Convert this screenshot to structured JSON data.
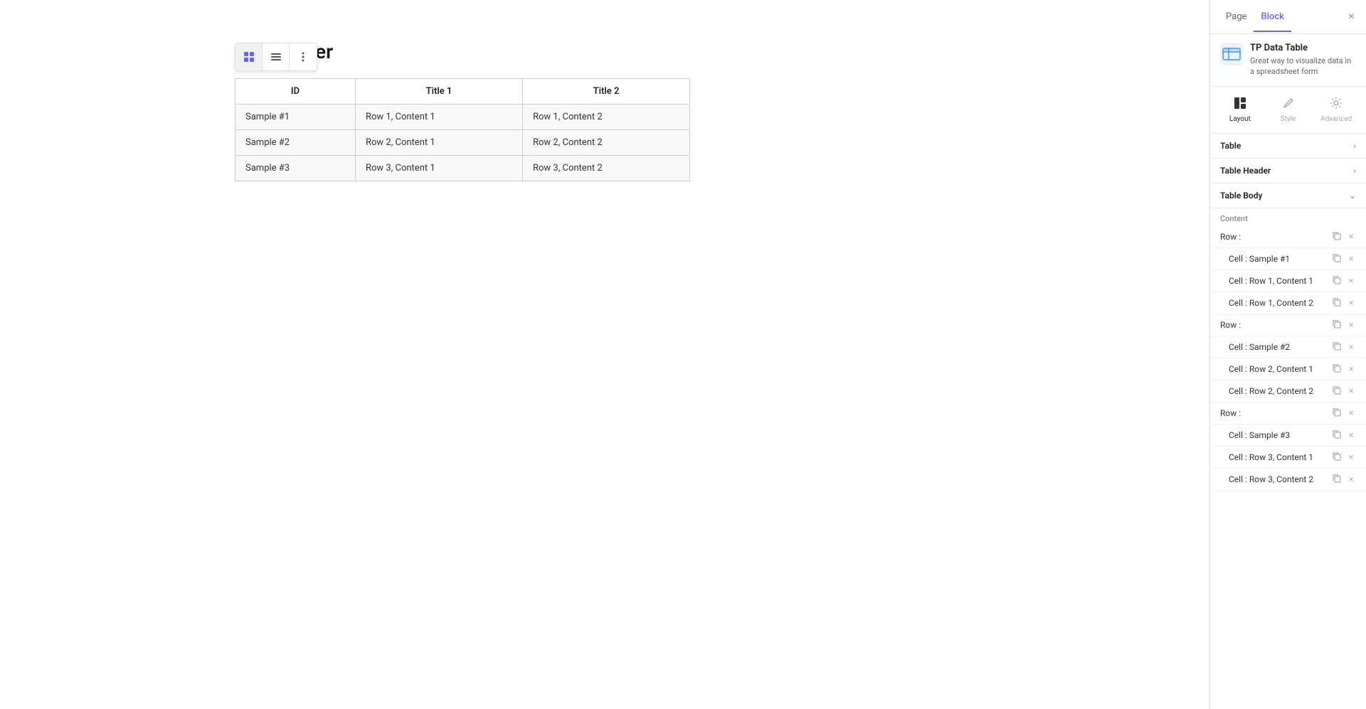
{
  "canvas": {
    "header_text": "lder",
    "toolbar": {
      "btn1_label": "grid-icon",
      "btn2_label": "list-icon",
      "btn3_label": "more-icon"
    },
    "table": {
      "headers": [
        "ID",
        "Title 1",
        "Title 2"
      ],
      "rows": [
        [
          "Sample #1",
          "Row 1, Content 1",
          "Row 1, Content 2"
        ],
        [
          "Sample #2",
          "Row 2, Content 1",
          "Row 2, Content 2"
        ],
        [
          "Sample #3",
          "Row 3, Content 1",
          "Row 3, Content 2"
        ]
      ]
    }
  },
  "panel": {
    "tabs": {
      "page": "Page",
      "block": "Block"
    },
    "active_tab": "Block",
    "close_label": "×",
    "plugin": {
      "name": "TP Data Table",
      "description": "Great way to visualize data in a spreadsheet form"
    },
    "view_tabs": [
      {
        "label": "Layout",
        "active": true
      },
      {
        "label": "Style",
        "active": false
      },
      {
        "label": "Advanced",
        "active": false
      }
    ],
    "sections": {
      "table": "Table",
      "table_header": "Table Header",
      "table_body": "Table Body"
    },
    "content_label": "Content",
    "tree_items": [
      {
        "label": "Row :",
        "indent": 0
      },
      {
        "label": "Cell : Sample #1",
        "indent": 1
      },
      {
        "label": "Cell : Row 1, Content 1",
        "indent": 1
      },
      {
        "label": "Cell : Row 1, Content 2",
        "indent": 1
      },
      {
        "label": "Row :",
        "indent": 0
      },
      {
        "label": "Cell : Sample #2",
        "indent": 1
      },
      {
        "label": "Cell : Row 2, Content 1",
        "indent": 1
      },
      {
        "label": "Cell : Row 2, Content 2",
        "indent": 1
      },
      {
        "label": "Row :",
        "indent": 0
      },
      {
        "label": "Cell : Sample #3",
        "indent": 1
      },
      {
        "label": "Cell : Row 3, Content 1",
        "indent": 1
      },
      {
        "label": "Cell : Row 3, Content 2",
        "indent": 1
      }
    ]
  }
}
